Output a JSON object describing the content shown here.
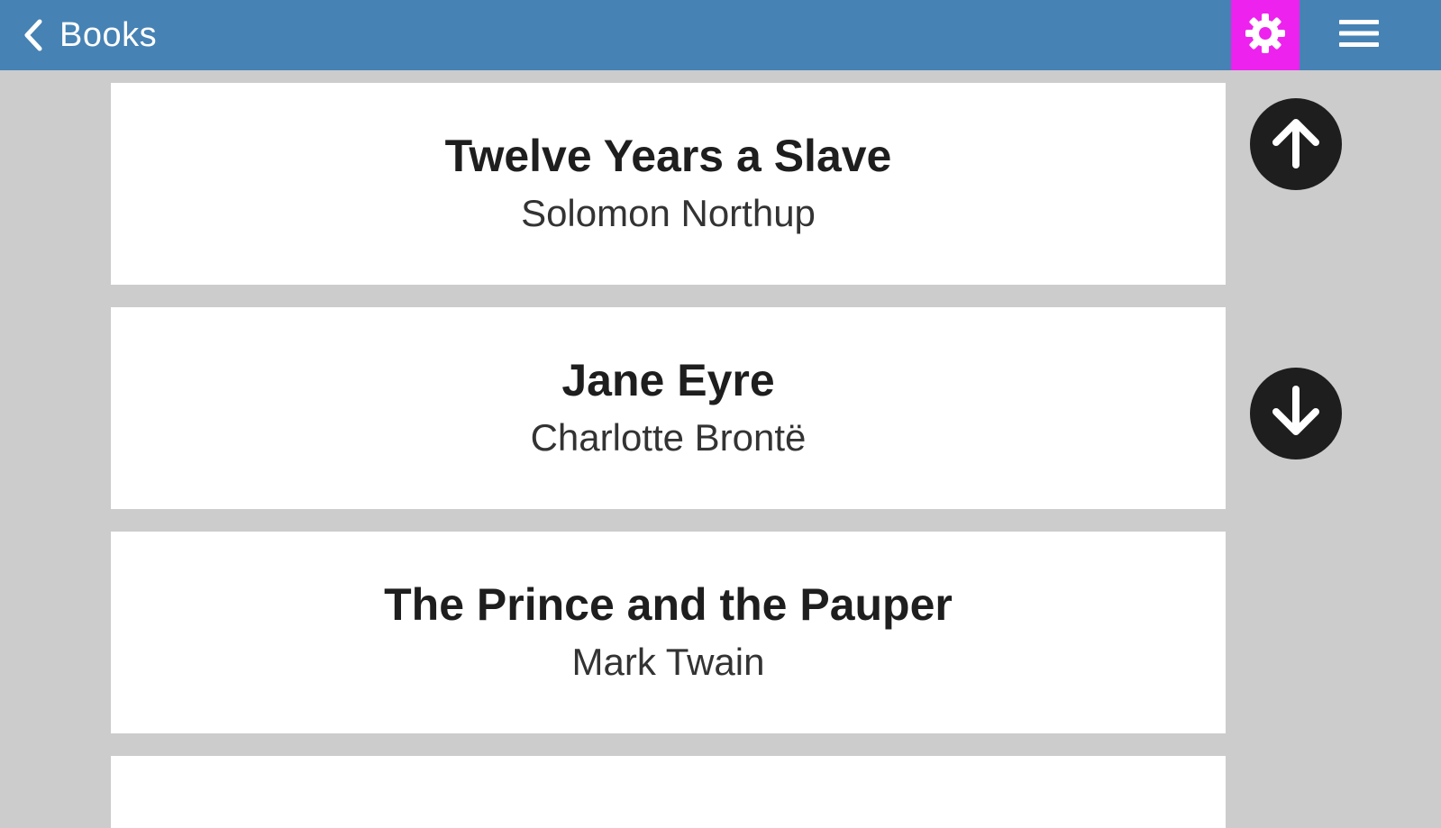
{
  "header": {
    "back_label": "Books",
    "back_icon": "chevron-left-icon",
    "settings_icon": "gear-icon",
    "menu_icon": "hamburger-menu-icon",
    "bar_color": "#4682b4",
    "settings_highlight_color": "#ee22ee"
  },
  "books": [
    {
      "title": "Twelve Years a Slave",
      "author": "Solomon Northup"
    },
    {
      "title": "Jane Eyre",
      "author": "Charlotte Brontë"
    },
    {
      "title": "The Prince and the Pauper",
      "author": "Mark Twain"
    }
  ],
  "scroll": {
    "up_icon": "arrow-up-circle-icon",
    "down_icon": "arrow-down-circle-icon"
  }
}
